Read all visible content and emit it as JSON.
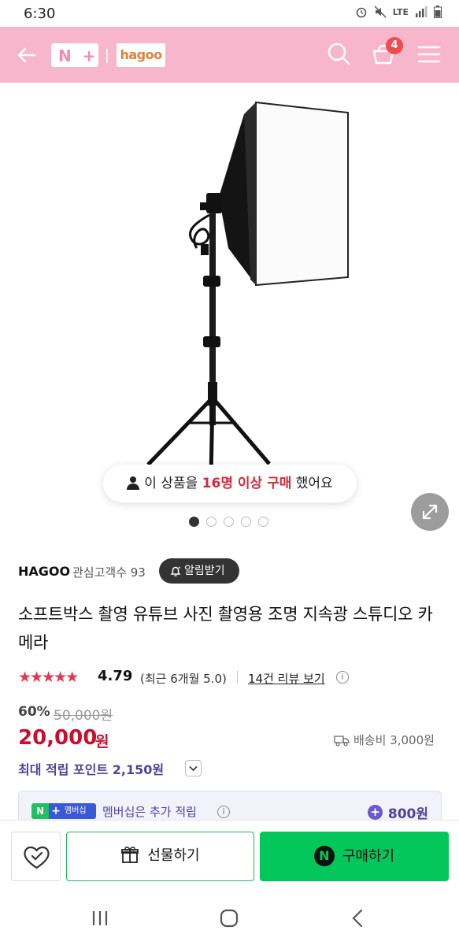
{
  "status_bar": {
    "time": "6:30",
    "network": "LTE"
  },
  "header": {
    "nplus_logo": "N+",
    "store_logo": "hagoo",
    "cart_count": "4",
    "bg_color": "#f8b6cd"
  },
  "gallery": {
    "purchase_prefix": "이 상품을 ",
    "purchase_highlight": "16명 이상 구매",
    "purchase_suffix": " 했어요",
    "page_count": 5,
    "active_page": 1
  },
  "store": {
    "name": "HAGOO",
    "fans": "관심고객수 93",
    "alarm_label": "알림받기"
  },
  "product": {
    "title": "소프트박스 촬영 유튜브 사진 촬영용 조명 지속광 스튜디오 카메라"
  },
  "rating": {
    "stars": "★★★★★",
    "score": "4.79",
    "recent": "(최근 6개월 5.0)",
    "review_link": "14건 리뷰 보기",
    "info": "i"
  },
  "price": {
    "discount_rate": "60%",
    "original": "50,000원",
    "sale": "20,000",
    "sale_unit": "원",
    "shipping": "배송비 3,000원",
    "points": "최대 적립 포인트 2,150원"
  },
  "membership": {
    "badge_n": "N",
    "badge_plus": "+",
    "badge_text": "멤버십",
    "text": "멤버십은 추가 적립",
    "info": "i",
    "plus": "+",
    "points": "800원"
  },
  "actions": {
    "gift_label": "선물하기",
    "buy_badge": "N",
    "buy_label": "구매하기"
  },
  "colors": {
    "accent_red": "#c8102e",
    "naver_green": "#03c75a",
    "points_purple": "#4d4399"
  }
}
